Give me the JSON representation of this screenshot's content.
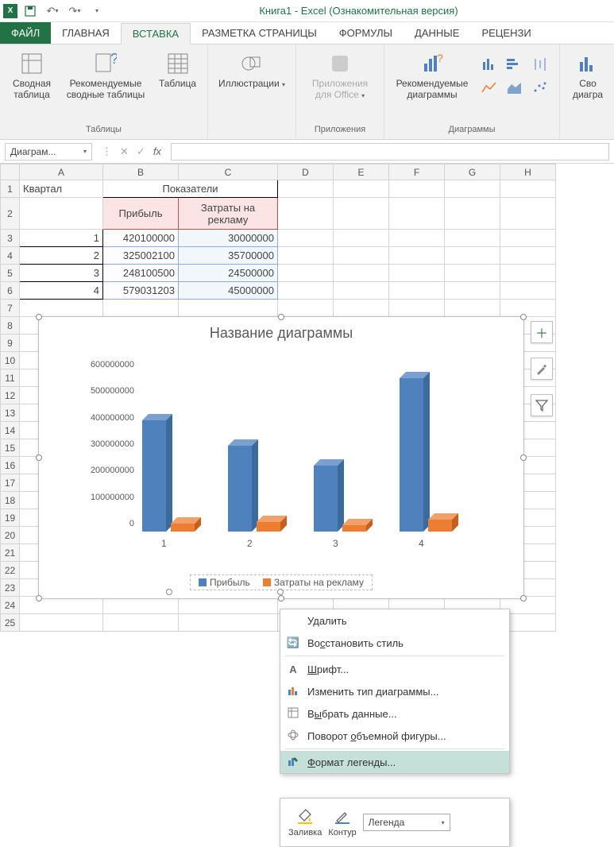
{
  "title": "Книга1 - Excel (Ознакомительная версия)",
  "tabs": {
    "file": "ФАЙЛ",
    "home": "ГЛАВНАЯ",
    "insert": "ВСТАВКА",
    "pagelayout": "РАЗМЕТКА СТРАНИЦЫ",
    "formulas": "ФОРМУЛЫ",
    "data": "ДАННЫЕ",
    "review": "РЕЦЕНЗИ"
  },
  "ribbon": {
    "pivot": "Сводная таблица",
    "recpivot": "Рекомендуемые сводные таблицы",
    "table": "Таблица",
    "tables_group": "Таблицы",
    "illustrations": "Иллюстрации",
    "apps": "Приложения для Office",
    "apps_group": "Приложения",
    "reccharts": "Рекомендуемые диаграммы",
    "charts_group": "Диаграммы",
    "pivotchart": "Сво диагра"
  },
  "name_box": "Диаграм...",
  "sheet": {
    "a1": "Квартал",
    "bc1": "Показатели",
    "b2": "Прибыль",
    "c2": "Затраты на рекламу",
    "rows": [
      {
        "q": "1",
        "b": "420100000",
        "c": "30000000"
      },
      {
        "q": "2",
        "b": "325002100",
        "c": "35700000"
      },
      {
        "q": "3",
        "b": "248100500",
        "c": "24500000"
      },
      {
        "q": "4",
        "b": "579031203",
        "c": "45000000"
      }
    ]
  },
  "columns": [
    "A",
    "B",
    "C",
    "D",
    "E",
    "F",
    "G",
    "H"
  ],
  "chart_data": {
    "type": "bar",
    "title": "Название диаграммы",
    "categories": [
      "1",
      "2",
      "3",
      "4"
    ],
    "series": [
      {
        "name": "Прибыль",
        "values": [
          420100000,
          325002100,
          248100500,
          579031203
        ],
        "color": "#4f81bd"
      },
      {
        "name": "Затраты на рекламу",
        "values": [
          30000000,
          35700000,
          24500000,
          45000000
        ],
        "color": "#ed7d31"
      }
    ],
    "ylim": [
      0,
      600000000
    ],
    "yticks": [
      "0",
      "100000000",
      "200000000",
      "300000000",
      "400000000",
      "500000000",
      "600000000"
    ]
  },
  "context_menu": {
    "delete": "Удалить",
    "reset_style_pre": "Во",
    "reset_style_u": "с",
    "reset_style_post": "становить стиль",
    "font_pre": "",
    "font_u": "Ш",
    "font_post": "рифт...",
    "change_type": "Изменить тип диаграммы...",
    "select_data_pre": "В",
    "select_data_u": "ы",
    "select_data_post": "брать данные...",
    "rotate_3d_pre": "Поворот ",
    "rotate_3d_u": "о",
    "rotate_3d_post": "бъемной фигуры...",
    "format_legend_pre": "",
    "format_legend_u": "Ф",
    "format_legend_post": "ормат легенды..."
  },
  "mini_toolbar": {
    "fill": "Заливка",
    "outline": "Контур",
    "select_label": "Легенда"
  }
}
